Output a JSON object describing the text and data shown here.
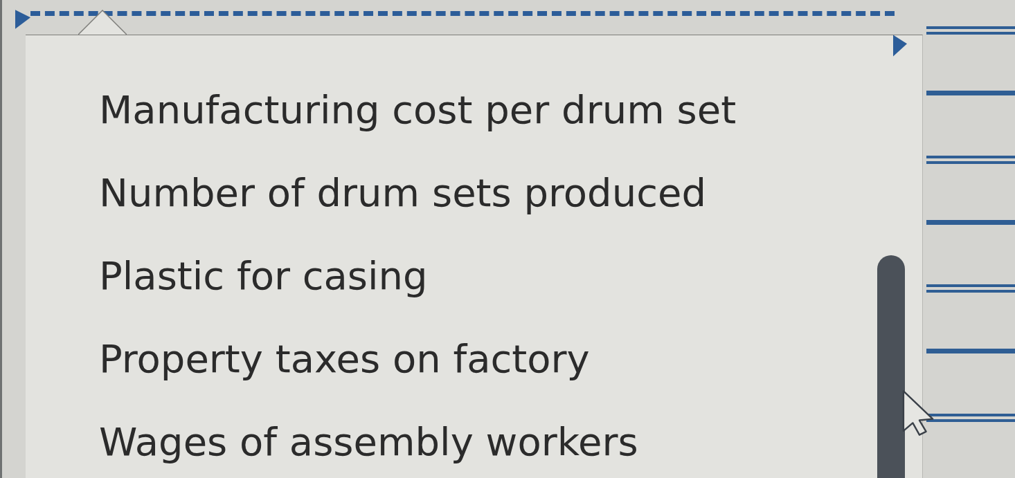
{
  "dropdown": {
    "options": [
      {
        "label": "Manufacturing cost per drum set",
        "selected": false
      },
      {
        "label": "Number of drum sets produced",
        "selected": false
      },
      {
        "label": "Plastic for casing",
        "selected": false
      },
      {
        "label": "Property taxes on factory",
        "selected": false
      },
      {
        "label": "Wages of assembly workers",
        "selected": false
      }
    ]
  },
  "answer_lines": [
    {
      "kind": "double"
    },
    {
      "kind": "single"
    },
    {
      "kind": "double"
    },
    {
      "kind": "single"
    },
    {
      "kind": "double"
    },
    {
      "kind": "single"
    },
    {
      "kind": "double"
    }
  ]
}
